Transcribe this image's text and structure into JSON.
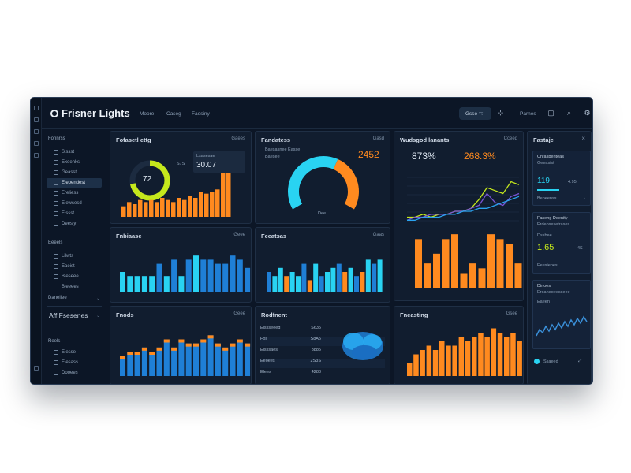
{
  "app": {
    "title": "Frisner Lights",
    "nav": [
      "Moore",
      "Caseg",
      "Faesiny"
    ],
    "pill_label": "Gsse",
    "profile_label": "Parnes"
  },
  "colors": {
    "background": "#0c1626",
    "panel": "#111d2f",
    "accent_orange": "#ff8a1f",
    "accent_cyan": "#29d3f2",
    "accent_blue": "#1f7fd6"
  },
  "icons": [
    "grid-icon",
    "chart-icon",
    "user-icon",
    "settings-icon",
    "calendar-icon",
    "search-icon",
    "bell-icon"
  ],
  "sidebar": {
    "top_label": "Fonnrss",
    "group1": [
      "Sissst",
      "Exeenks",
      "Geasst",
      "Eleoendest",
      "Ereliess",
      "Eiewsesd",
      "Eissst",
      "Deesly"
    ],
    "group2_head": "Eeeels",
    "group2": [
      "Lilwts",
      "Eaeist",
      "Bieseee",
      "Bieeees"
    ],
    "footer_label": "Daneliee",
    "big_label": "Aff Fsesenes",
    "group3_head": "Reels",
    "group3": [
      "Eiesse",
      "Eiesass",
      "Dooees"
    ]
  },
  "panels": {
    "p1": {
      "title": "Fofasetl ettg",
      "control": "Gaees",
      "donut_value": "72",
      "kpi_label": "Lsasesae",
      "kpi_value": "30.07",
      "kpi_small": "S7S"
    },
    "p2": {
      "title": "Fandatess",
      "control": "Gasd",
      "legend": [
        "Baesasnee Easse",
        "Baesee"
      ],
      "value": "2452",
      "bottom": "Dee"
    },
    "p3": {
      "title": "Wudsgod lanants",
      "control": "Cceed",
      "value_left": "873%",
      "value_right": "268.3%"
    },
    "p4": {
      "title": "Fnbiaase",
      "control": "Geee"
    },
    "p5": {
      "title": "Feeatsas",
      "control": "Gaas"
    },
    "p6": {
      "title": "Fnods",
      "control": "Geee"
    },
    "p7": {
      "title": "Rodfnent",
      "rows": [
        [
          "Eissseeed",
          "S635"
        ],
        [
          "Fos",
          "S8A5"
        ],
        [
          "Eisssaes",
          "3885"
        ],
        [
          "Eeoees",
          "2S3S"
        ],
        [
          "Elees",
          "4288"
        ]
      ]
    },
    "p8": {
      "title": "Fneasting",
      "control": "Gsee"
    }
  },
  "right_panel": {
    "title": "Fastaje",
    "card1": {
      "title": "Cnfasbenteas",
      "subtitle": "Geeasist",
      "value": "119",
      "value_right": "4.95",
      "button": "Beneenss"
    },
    "card2": {
      "title": "Faseng Deenity",
      "subtitle": "Erdeosesetrases",
      "mini_label": "Dssbee",
      "value": "1.65",
      "value_right": "4S",
      "button": "Eeesienes"
    },
    "card3": {
      "title": "Dinoes",
      "subtitle": "Eroaneoeesseee",
      "mini_label": "Eaeen"
    },
    "footer_label": "Ssaeed"
  },
  "chart_data": [
    {
      "type": "bar",
      "name": "p1-bars",
      "values": [
        5,
        7,
        6,
        8,
        7,
        8,
        7,
        9,
        8,
        7,
        9,
        8,
        10,
        9,
        12,
        11,
        12,
        13,
        21,
        27
      ],
      "ylim": [
        0,
        30
      ]
    },
    {
      "type": "bar",
      "name": "p4-bars",
      "categories": [
        "1",
        "2",
        "3",
        "4",
        "5",
        "6",
        "7",
        "8",
        "9",
        "10",
        "11",
        "12",
        "13",
        "14",
        "15",
        "16",
        "17",
        "18"
      ],
      "series": [
        {
          "values": [
            5,
            4,
            4,
            4,
            4,
            7,
            4,
            8,
            4,
            8,
            9,
            8,
            8,
            7,
            7,
            9,
            8,
            6
          ]
        }
      ],
      "ylim": [
        0,
        10
      ]
    },
    {
      "type": "bar",
      "name": "p5-bars",
      "values": [
        5,
        4,
        6,
        4,
        5,
        4,
        7,
        3,
        7,
        4,
        5,
        6,
        7,
        5,
        6,
        4,
        5,
        8,
        7,
        8
      ],
      "ylim": [
        0,
        10
      ]
    },
    {
      "type": "bar",
      "name": "p6-bars",
      "values": [
        5,
        6,
        6,
        7,
        6,
        7,
        9,
        7,
        9,
        8,
        8,
        9,
        10,
        8,
        7,
        8,
        9,
        8
      ],
      "ylim": [
        0,
        12
      ]
    },
    {
      "type": "bar",
      "name": "p8-bars",
      "values": [
        3,
        5,
        6,
        7,
        6,
        8,
        7,
        7,
        9,
        8,
        9,
        10,
        9,
        11,
        10,
        9,
        10,
        8
      ],
      "ylim": [
        0,
        12
      ]
    },
    {
      "type": "bar",
      "name": "p3-bars",
      "values": [
        10,
        5,
        7,
        10,
        11,
        3,
        5,
        4,
        11,
        10,
        9,
        5
      ],
      "ylim": [
        0,
        12
      ]
    },
    {
      "type": "line",
      "name": "p3-lines",
      "series": [
        {
          "values": [
            2,
            2,
            3,
            2,
            3,
            3,
            4,
            4,
            5,
            8,
            12,
            11,
            10,
            14,
            13
          ]
        },
        {
          "values": [
            1,
            2,
            2,
            3,
            3,
            3,
            4,
            4,
            5,
            6,
            10,
            7,
            6,
            9,
            10
          ]
        },
        {
          "values": [
            1,
            1,
            2,
            2,
            2,
            3,
            3,
            4,
            4,
            5,
            5,
            6,
            7,
            8,
            9
          ]
        }
      ],
      "ylim": [
        0,
        16
      ]
    },
    {
      "type": "pie",
      "name": "p1-donut",
      "values": [
        72,
        28
      ]
    },
    {
      "type": "pie",
      "name": "p2-gauge",
      "values": [
        60,
        40
      ]
    }
  ]
}
